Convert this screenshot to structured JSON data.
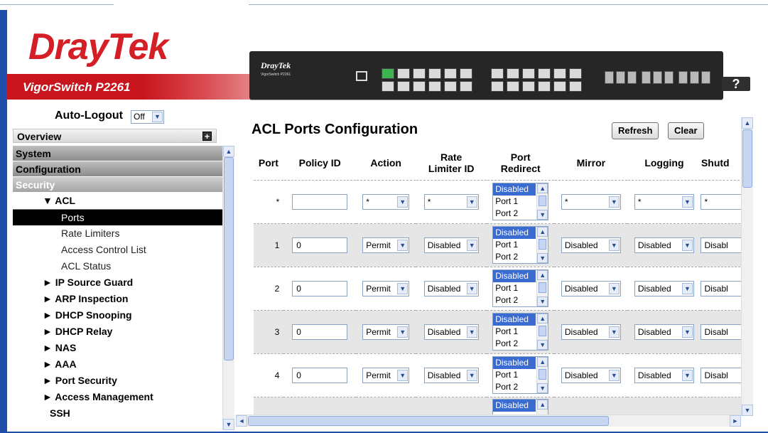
{
  "header": {
    "logo_dray": "Dray",
    "logo_tek": "Tek",
    "model": "VigorSwitch P2261",
    "device_brand": "DrayTek",
    "device_sub": "VigorSwitch P2261",
    "help_label": "?"
  },
  "sidebar": {
    "autologout_label": "Auto-Logout",
    "autologout_value": "Off",
    "overview": "Overview",
    "system": "System",
    "configuration": "Configuration",
    "security": "Security",
    "acl": "▼ ACL",
    "acl_items": [
      "Ports",
      "Rate Limiters",
      "Access Control List",
      "ACL Status"
    ],
    "groups": [
      "► IP Source Guard",
      "► ARP Inspection",
      "► DHCP Snooping",
      "► DHCP Relay",
      "► NAS",
      "► AAA",
      "► Port Security",
      "► Access Management"
    ],
    "cut_item": "SSH"
  },
  "main": {
    "title": "ACL Ports Configuration",
    "refresh_label": "Refresh",
    "clear_label": "Clear",
    "columns": [
      "Port",
      "Policy ID",
      "Action",
      "Rate Limiter ID",
      "Port Redirect",
      "Mirror",
      "Logging",
      "Shutd"
    ],
    "rows": [
      {
        "port": "*",
        "policy": "",
        "action": "*",
        "rate": "*",
        "redirect": [
          "Disabled",
          "Port 1",
          "Port 2"
        ],
        "mirror": "*",
        "logging": "*",
        "shutdown": "*"
      },
      {
        "port": "1",
        "policy": "0",
        "action": "Permit",
        "rate": "Disabled",
        "redirect": [
          "Disabled",
          "Port 1",
          "Port 2"
        ],
        "mirror": "Disabled",
        "logging": "Disabled",
        "shutdown": "Disabl"
      },
      {
        "port": "2",
        "policy": "0",
        "action": "Permit",
        "rate": "Disabled",
        "redirect": [
          "Disabled",
          "Port 1",
          "Port 2"
        ],
        "mirror": "Disabled",
        "logging": "Disabled",
        "shutdown": "Disabl"
      },
      {
        "port": "3",
        "policy": "0",
        "action": "Permit",
        "rate": "Disabled",
        "redirect": [
          "Disabled",
          "Port 1",
          "Port 2"
        ],
        "mirror": "Disabled",
        "logging": "Disabled",
        "shutdown": "Disabl"
      },
      {
        "port": "4",
        "policy": "0",
        "action": "Permit",
        "rate": "Disabled",
        "redirect": [
          "Disabled",
          "Port 1",
          "Port 2"
        ],
        "mirror": "Disabled",
        "logging": "Disabled",
        "shutdown": "Disabl"
      }
    ],
    "partial_row_redirect": "Disabled"
  },
  "colors": {
    "brand_red": "#d51f26",
    "frame_blue": "#1f4ea8",
    "selected_option": "#3a6bd1"
  }
}
